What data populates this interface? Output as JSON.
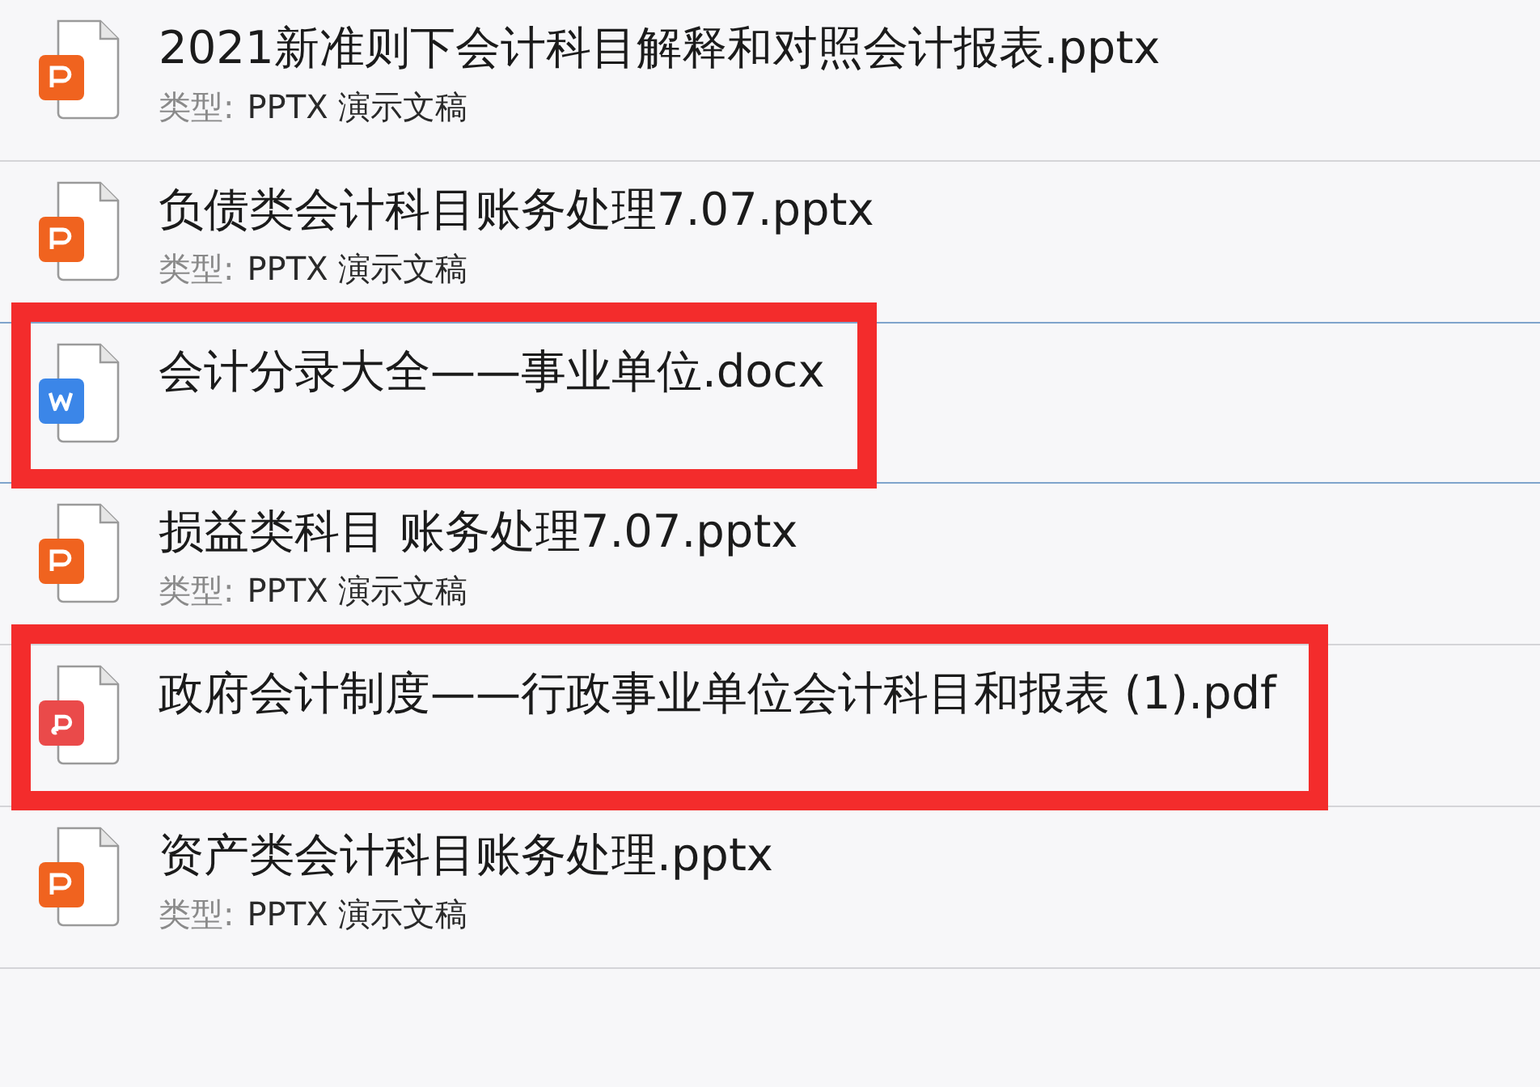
{
  "files": [
    {
      "kind": "pptx",
      "name": "2021新准则下会计科目解释和对照会计报表.pptx",
      "type_label": "类型:",
      "type_value": "PPTX 演示文稿",
      "selected": false,
      "highlighted": false
    },
    {
      "kind": "pptx",
      "name": "负债类会计科目账务处理7.07.pptx",
      "type_label": "类型:",
      "type_value": "PPTX 演示文稿",
      "selected": false,
      "highlighted": false
    },
    {
      "kind": "docx",
      "name": "会计分录大全——事业单位.docx",
      "selected": true,
      "highlighted": true
    },
    {
      "kind": "pptx",
      "name": "损益类科目 账务处理7.07.pptx",
      "type_label": "类型:",
      "type_value": "PPTX 演示文稿",
      "selected": false,
      "highlighted": false
    },
    {
      "kind": "pdf",
      "name": "政府会计制度——行政事业单位会计科目和报表 (1).pdf",
      "selected": false,
      "highlighted": true
    },
    {
      "kind": "pptx",
      "name": "资产类会计科目账务处理.pptx",
      "type_label": "类型:",
      "type_value": "PPTX 演示文稿",
      "selected": false,
      "highlighted": false
    }
  ]
}
